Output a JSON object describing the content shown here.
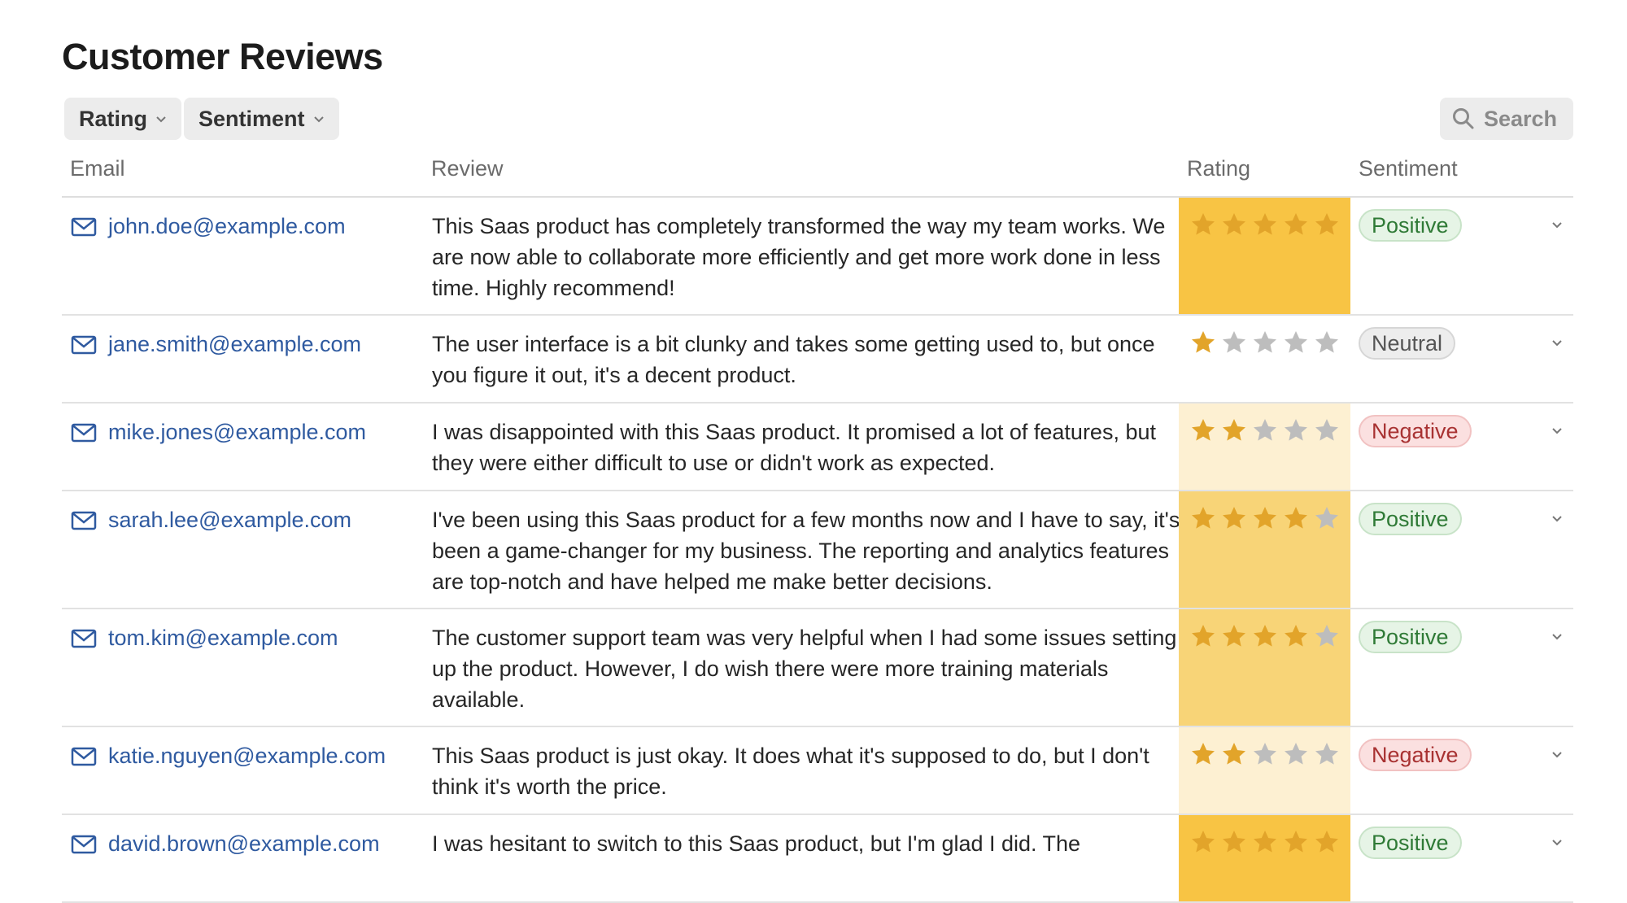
{
  "page": {
    "title": "Customer Reviews"
  },
  "toolbar": {
    "filters": [
      {
        "label": "Rating",
        "icon": "chevron-down-icon"
      },
      {
        "label": "Sentiment",
        "icon": "chevron-down-icon"
      }
    ],
    "search_label": "Search"
  },
  "columns": {
    "email": "Email",
    "review": "Review",
    "rating": "Rating",
    "sentiment": "Sentiment"
  },
  "colors": {
    "star_filled": "#e2a42a",
    "star_empty": "#bdbdbd",
    "rating_high_bg": "#f8c444",
    "rating_mid_bg": "#f8d477",
    "rating_low_bg": "#fdf0d2",
    "email_link": "#2f5aa0"
  },
  "rows": [
    {
      "email": "john.doe@example.com",
      "review": "This Saas product has completely transformed the way my team works. We are now able to collaborate more efficiently and get more work done in less time. Highly recommend!",
      "rating": 5,
      "sentiment": "Positive"
    },
    {
      "email": "jane.smith@example.com",
      "review": "The user interface is a bit clunky and takes some getting used to, but once you figure it out, it's a decent product.",
      "rating": 1,
      "sentiment": "Neutral"
    },
    {
      "email": "mike.jones@example.com",
      "review": "I was disappointed with this Saas product. It promised a lot of features, but they were either difficult to use or didn't work as expected.",
      "rating": 2,
      "sentiment": "Negative"
    },
    {
      "email": "sarah.lee@example.com",
      "review": "I've been using this Saas product for a few months now and I have to say, it's been a game-changer for my business. The reporting and analytics features are top-notch and have helped me make better decisions.",
      "rating": 4,
      "sentiment": "Positive"
    },
    {
      "email": "tom.kim@example.com",
      "review": "The customer support team was very helpful when I had some issues setting up the product. However, I do wish there were more training materials available.",
      "rating": 4,
      "sentiment": "Positive"
    },
    {
      "email": "katie.nguyen@example.com",
      "review": "This Saas product is just okay. It does what it's supposed to do, but I don't think it's worth the price.",
      "rating": 2,
      "sentiment": "Negative"
    },
    {
      "email": "david.brown@example.com",
      "review": "I was hesitant to switch to this Saas product, but I'm glad I did. The",
      "rating": 5,
      "sentiment": "Positive"
    }
  ]
}
